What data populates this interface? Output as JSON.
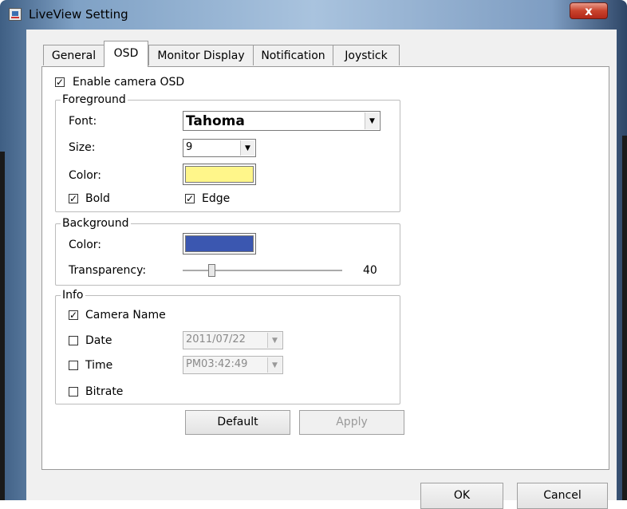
{
  "window": {
    "title": "LiveView Setting",
    "close_glyph": "x"
  },
  "tabs": [
    {
      "label": "General",
      "active": false
    },
    {
      "label": "OSD",
      "active": true
    },
    {
      "label": "Monitor Display",
      "active": false
    },
    {
      "label": "Notification",
      "active": false
    },
    {
      "label": "Joystick",
      "active": false
    }
  ],
  "osd": {
    "enable_label": "Enable camera OSD",
    "enable_checked": true,
    "foreground": {
      "title": "Foreground",
      "font_label": "Font:",
      "font_value": "Tahoma",
      "size_label": "Size:",
      "size_value": "9",
      "color_label": "Color:",
      "color_value": "#fff68a",
      "bold_label": "Bold",
      "bold_checked": true,
      "edge_label": "Edge",
      "edge_checked": true
    },
    "background": {
      "title": "Background",
      "color_label": "Color:",
      "color_value": "#3b57b0",
      "transparency_label": "Transparency:",
      "transparency_value": "40",
      "transparency_fraction": 0.17
    },
    "info": {
      "title": "Info",
      "camera_name_label": "Camera Name",
      "camera_name_checked": true,
      "date_label": "Date",
      "date_checked": false,
      "date_value": "2011/07/22",
      "time_label": "Time",
      "time_checked": false,
      "time_value": "PM03:42:49",
      "bitrate_label": "Bitrate",
      "bitrate_checked": false
    },
    "default_label": "Default",
    "apply_label": "Apply"
  },
  "footer": {
    "ok_label": "OK",
    "cancel_label": "Cancel"
  },
  "check_glyph": "✓",
  "arrow_glyph": "▼"
}
